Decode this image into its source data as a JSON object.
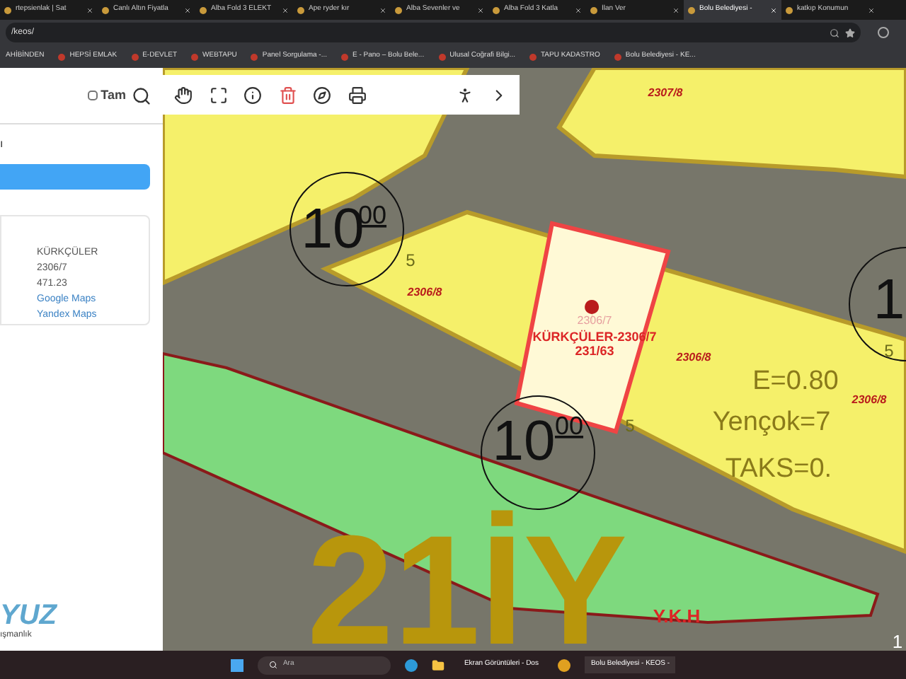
{
  "tabs": [
    {
      "label": "rtepsienlak | Sat",
      "selected": false
    },
    {
      "label": "Canlı Altın Fiyatla",
      "selected": false
    },
    {
      "label": "Alba Fold 3 ELEKT",
      "selected": false
    },
    {
      "label": "Ape ryder kır",
      "selected": false
    },
    {
      "label": "Alba Sevenler ve",
      "selected": false
    },
    {
      "label": "Alba Fold 3 Katla",
      "selected": false
    },
    {
      "label": "İlan Ver",
      "selected": false
    },
    {
      "label": "Bolu Belediyesi -",
      "selected": true
    },
    {
      "label": "katkıp Konumun",
      "selected": false
    }
  ],
  "address": "/keos/",
  "bookmarks": [
    "AHİBİNDEN",
    "HEPSİ EMLAK",
    "E-DEVLET",
    "WEBTAPU",
    "Panel Sorgulama -...",
    "E - Pano – Bolu Bele...",
    "Ulusal Coğrafi Bilgi...",
    "TAPU KADASTRO",
    "Bolu Belediyesi - KE..."
  ],
  "panel": {
    "full_checkbox": {
      "label": "Tam",
      "checked": false
    },
    "fragment": "ı",
    "info": [
      "KÜRKÇÜLER",
      "2306/7",
      "471.23"
    ],
    "links": [
      "Google Maps",
      "Yandex Maps"
    ],
    "logo": {
      "name": "YUZ",
      "tagline": "ışmanlık"
    }
  },
  "map": {
    "labels": [
      {
        "kind": "parcel",
        "text": "2307/8"
      },
      {
        "kind": "big",
        "text": "10"
      },
      {
        "kind": "sup",
        "text": "00"
      },
      {
        "kind": "small",
        "text": "5"
      },
      {
        "kind": "parcel",
        "text": "2306/8"
      },
      {
        "kind": "faint",
        "text": "2306/7"
      },
      {
        "kind": "selected",
        "text": "KÜRKÇÜLER-2306/7"
      },
      {
        "kind": "selected",
        "text": "231/63"
      },
      {
        "kind": "big",
        "text": "1"
      },
      {
        "kind": "parcel",
        "text": "2306/8"
      },
      {
        "kind": "small",
        "text": "5"
      },
      {
        "kind": "zone",
        "text": "E=0.80"
      },
      {
        "kind": "parcel",
        "text": "2306/8"
      },
      {
        "kind": "big",
        "text": "10"
      },
      {
        "kind": "sup",
        "text": "00"
      },
      {
        "kind": "small",
        "text": "5"
      },
      {
        "kind": "zone",
        "text": "Yençok=7"
      },
      {
        "kind": "zone",
        "text": "TAKS=0."
      },
      {
        "kind": "huge",
        "text": "21İY"
      },
      {
        "kind": "road",
        "text": "Y.K.H"
      },
      {
        "kind": "edge",
        "text": "1"
      }
    ]
  },
  "taskbar": {
    "search_placeholder": "Ara",
    "apps": [
      "Ekran Görüntüleri - Dos",
      "Bolu Belediyesi - KEOS -"
    ]
  }
}
